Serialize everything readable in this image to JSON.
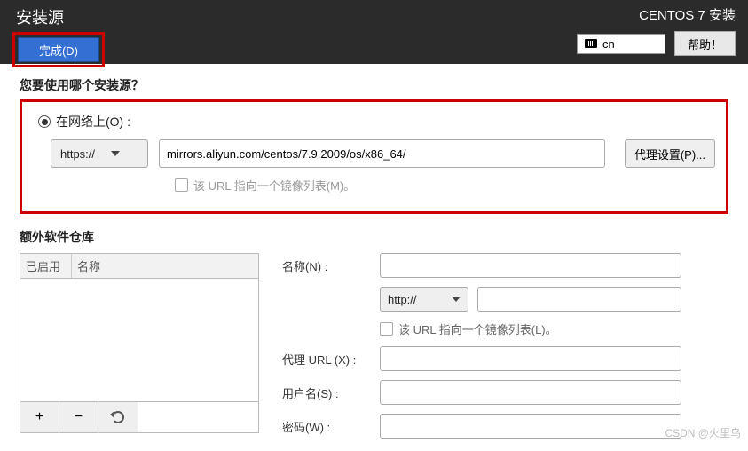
{
  "header": {
    "title": "安装源",
    "done_label": "完成(D)",
    "installer_title": "CENTOS 7 安装",
    "language": "cn",
    "help_label": "帮助！"
  },
  "source": {
    "question": "您要使用哪个安装源？",
    "radio_network_label": "在网络上(O) :",
    "protocol_selected": "https://",
    "url_value": "mirrors.aliyun.com/centos/7.9.2009/os/x86_64/",
    "proxy_button": "代理设置(P)...",
    "mirror_checkbox_label": "该 URL 指向一个镜像列表(M)。"
  },
  "repos": {
    "title": "额外软件仓库",
    "col_enabled": "已启用",
    "col_name": "名称",
    "form": {
      "name_label": "名称(N) :",
      "protocol_selected": "http://",
      "mirror_label": "该 URL 指向一个镜像列表(L)。",
      "proxy_url_label": "代理 URL (X) :",
      "user_label": "用户名(S) :",
      "password_label": "密码(W) :"
    }
  },
  "watermark": "CSDN @火里鸟"
}
